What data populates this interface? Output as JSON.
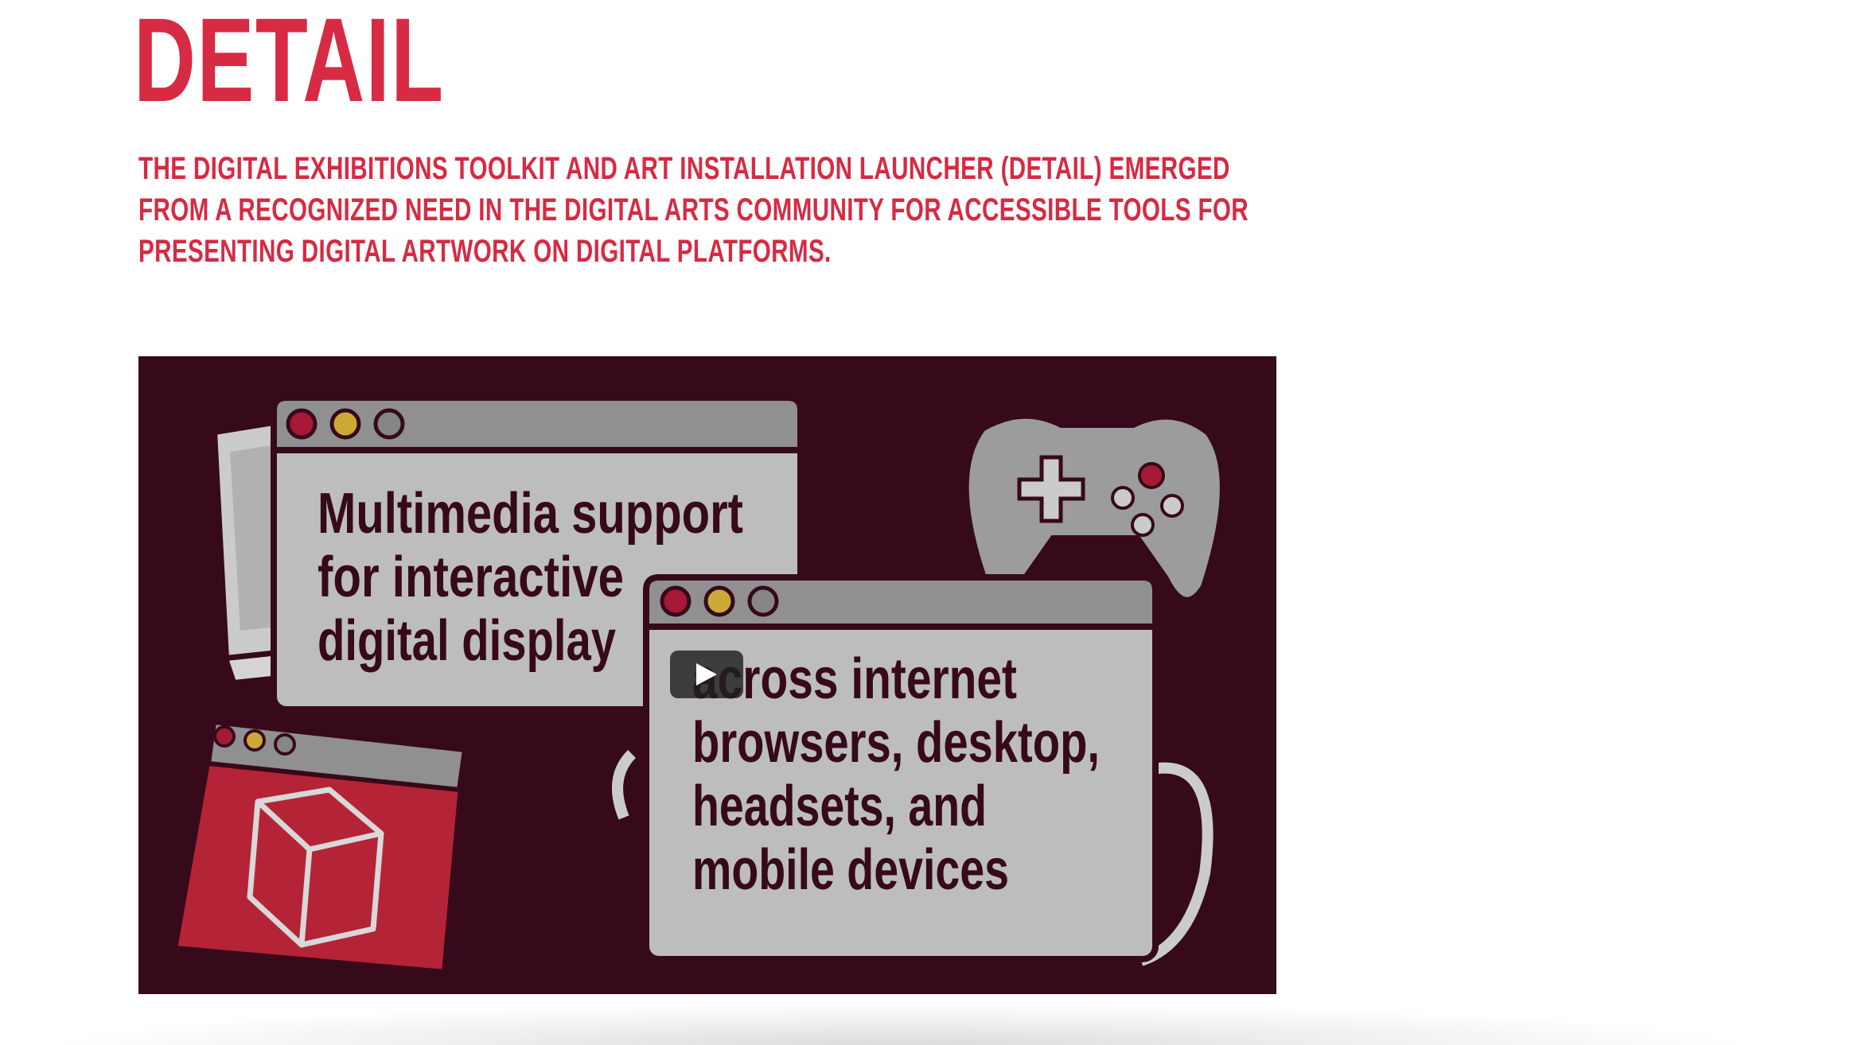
{
  "page": {
    "title": "DETAIL",
    "intro": "THE DIGITAL EXHIBITIONS TOOLKIT AND ART INSTALLATION LAUNCHER (DETAIL) EMERGED FROM A RECOGNIZED NEED IN THE DIGITAL ARTS COMMUNITY FOR ACCESSIBLE TOOLS FOR PRESENTING DIGITAL ARTWORK ON DIGITAL PLATFORMS."
  },
  "video": {
    "window1_lines": [
      "Multimedia support",
      "for interactive",
      "digital display"
    ],
    "window2_lines": [
      "across internet",
      "browsers, desktop,",
      "headsets, and",
      "mobile devices"
    ],
    "play_icon": "play-icon"
  },
  "colors": {
    "accent": "#d72a43",
    "video_bg": "#3a0a1d",
    "window_body": "#c9c9c9",
    "window_bar": "#9a9a9a",
    "dot_red": "#b01a3a",
    "dot_yellow": "#d9b43a",
    "dot_grey": "#8f8f8f",
    "cube_panel": "#c0273a"
  }
}
